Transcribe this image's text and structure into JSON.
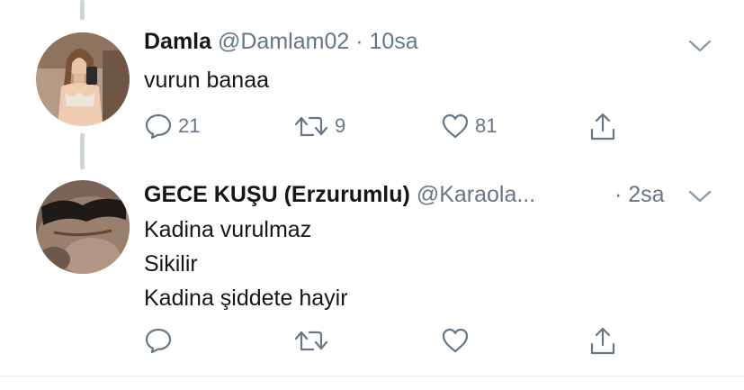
{
  "tweets": [
    {
      "name": "Damla",
      "handle": "@Damlam02",
      "separator": "·",
      "time": "10sa",
      "lines": [
        "vurun banaa"
      ],
      "replies": "21",
      "retweets": "9",
      "likes": "81"
    },
    {
      "name": "GECE KUŞU (Erzurumlu)",
      "handle": "@Karaola...",
      "separator": "·",
      "time": "2sa",
      "lines": [
        "Kadina vurulmaz",
        "Sikilir",
        "Kadina şiddete hayir"
      ],
      "replies": "",
      "retweets": "",
      "likes": ""
    }
  ],
  "icons": {
    "reply": "reply-icon",
    "retweet": "retweet-icon",
    "like": "heart-icon",
    "share": "share-icon",
    "menu": "chevron-down-icon"
  },
  "colors": {
    "text": "#14171a",
    "meta": "#657786",
    "thread_line": "#ccd6dd"
  }
}
